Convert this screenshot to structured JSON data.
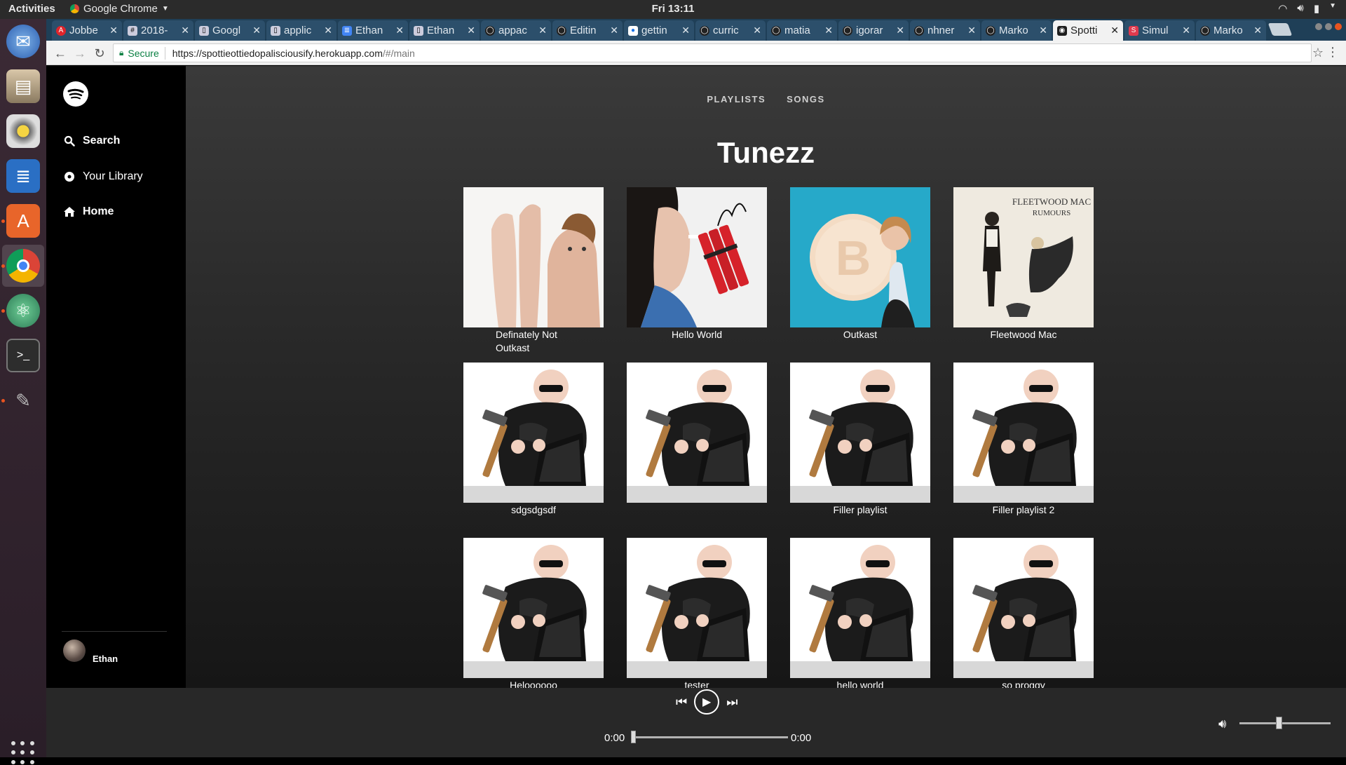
{
  "topbar": {
    "activities": "Activities",
    "app_menu": "Google Chrome",
    "clock": "Fri 13:11"
  },
  "dock": {
    "apps": [
      "thunderbird-icon",
      "files-icon",
      "rhythmbox-icon",
      "writer-icon",
      "software-center-icon",
      "chrome-icon",
      "atom-icon",
      "terminal-icon",
      "gimp-icon"
    ],
    "show_apps_icon": "grid-icon"
  },
  "browser": {
    "tabs": [
      {
        "label": "Jobbe",
        "favicon": "A"
      },
      {
        "label": "2018-",
        "favicon": "#"
      },
      {
        "label": "Googl",
        "favicon": "doc"
      },
      {
        "label": "applic",
        "favicon": "doc"
      },
      {
        "label": "Ethan",
        "favicon": "docs"
      },
      {
        "label": "Ethan",
        "favicon": "doc"
      },
      {
        "label": "appac",
        "favicon": "github"
      },
      {
        "label": "Editin",
        "favicon": "github"
      },
      {
        "label": "gettin",
        "favicon": "dot"
      },
      {
        "label": "curric",
        "favicon": "github"
      },
      {
        "label": "matia",
        "favicon": "github"
      },
      {
        "label": "igorar",
        "favicon": "github"
      },
      {
        "label": "nhner",
        "favicon": "github"
      },
      {
        "label": "Marko",
        "favicon": "github"
      },
      {
        "label": "Spotti",
        "favicon": "spotify"
      },
      {
        "label": "Simul",
        "favicon": "S"
      },
      {
        "label": "Marko",
        "favicon": "github"
      }
    ],
    "active_tab_index": 14,
    "secure_label": "Secure",
    "url": "https://spottieottiedopalisciousify.herokuapp.com",
    "url_hash": "/#/main"
  },
  "sidebar": {
    "items": [
      {
        "label": "Search",
        "icon": "search-icon"
      },
      {
        "label": "Your Library",
        "icon": "library-icon"
      },
      {
        "label": "Home",
        "icon": "home-icon"
      }
    ],
    "user": {
      "name": "Ethan"
    }
  },
  "main": {
    "tabs": [
      "PLAYLISTS",
      "SONGS"
    ],
    "title": "Tunezz",
    "playlists": [
      {
        "label": "Definately Not Outkast",
        "art": "feet"
      },
      {
        "label": "Hello World",
        "art": "smoke"
      },
      {
        "label": "Outkast",
        "art": "bitcoin"
      },
      {
        "label": "Fleetwood Mac",
        "art": "fleet"
      },
      {
        "label": "sdgsdgsdf",
        "art": "hammer"
      },
      {
        "label": "",
        "art": "hammer"
      },
      {
        "label": "Filler playlist",
        "art": "hammer"
      },
      {
        "label": "Filler playlist 2",
        "art": "hammer"
      },
      {
        "label": "Heloooooo",
        "art": "hammer"
      },
      {
        "label": "tester",
        "art": "hammer"
      },
      {
        "label": "hello world",
        "art": "hammer"
      },
      {
        "label": "so proggy",
        "art": "hammer"
      }
    ],
    "fleetwood_art_text": "FLEETWOOD MAC\nRUMOURS"
  },
  "player": {
    "time_elapsed": "0:00",
    "time_total": "0:00",
    "progress_fraction": 0.0,
    "volume_fraction": 0.4
  }
}
